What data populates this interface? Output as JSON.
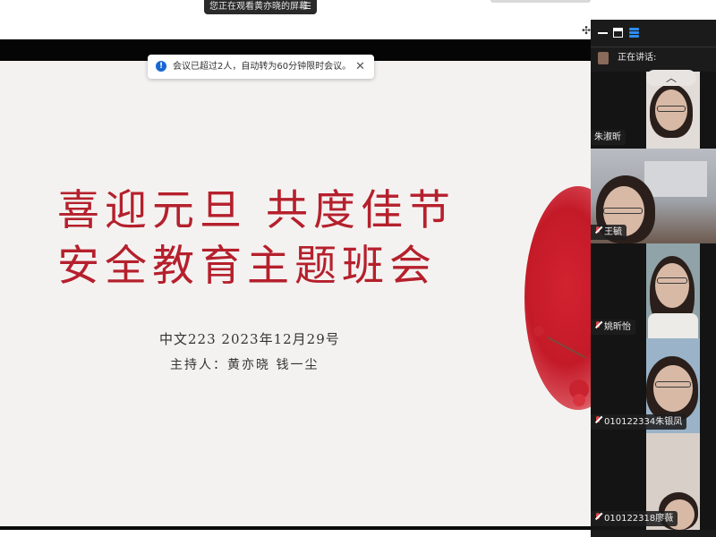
{
  "share_banner": {
    "text": "您正在观看黄亦晓的屏幕",
    "menu_glyph": "☰"
  },
  "notification": {
    "text": "会议已超过2人，自动转为60分钟限时会议。",
    "info_glyph": "!",
    "close_glyph": "✕",
    "accent": "#1967d2"
  },
  "slide": {
    "title_line_1": "喜迎元旦 共度佳节",
    "title_line_2": "安全教育主题班会",
    "class_line": "中文223 2023年12月29号",
    "host_line": "主持人：黄亦晓 钱一尘",
    "title_color": "#b5202c"
  },
  "right_panel": {
    "speaking_label": "正在讲话:",
    "collapse_glyph": "︿",
    "participants": [
      {
        "name": "朱淑昕",
        "muted": false
      },
      {
        "name": "王毓",
        "muted": true
      },
      {
        "name": "姚昕怡",
        "muted": true
      },
      {
        "name": "010122334朱银凤",
        "muted": true
      },
      {
        "name": "010122318廖薇",
        "muted": true
      }
    ]
  },
  "icons": [
    "minimize-icon",
    "window-icon",
    "stack-icon",
    "info-icon",
    "close-icon",
    "mic-muted-icon",
    "menu-icon",
    "pin-icon"
  ],
  "pin_glyph": "✣"
}
